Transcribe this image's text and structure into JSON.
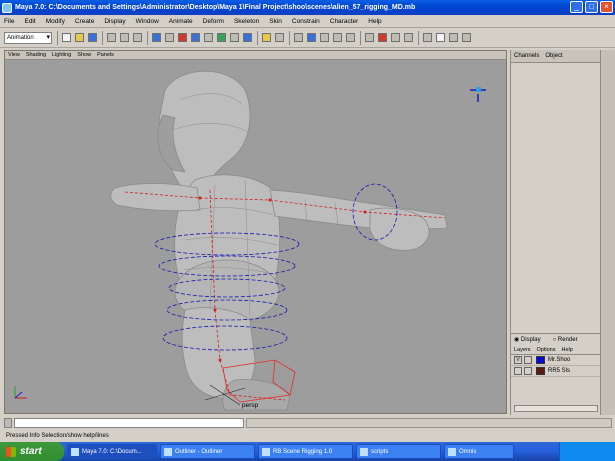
{
  "window": {
    "title": "Maya 7.0: C:\\Documents and Settings\\Administrator\\Desktop\\Maya 1\\Final Project\\shoo\\scenes\\alien_57_rigging_MD.mb",
    "minimize": "_",
    "maximize": "□",
    "close": "×"
  },
  "menubar": [
    "File",
    "Edit",
    "Modify",
    "Create",
    "Display",
    "Window",
    "Animate",
    "Deform",
    "Skeleton",
    "Skin",
    "Constrain",
    "Character",
    "Help"
  ],
  "toolbar": {
    "mode": "Animation"
  },
  "panel": {
    "menu": [
      "View",
      "Shading",
      "Lighting",
      "Show",
      "Panels"
    ],
    "camera": "persp"
  },
  "channel_box": {
    "tabs": [
      "Channels",
      "Object"
    ]
  },
  "layer_editor": {
    "radio": [
      "Display",
      "Render"
    ],
    "menu": [
      "Layers",
      "Options",
      "Help"
    ],
    "layers": [
      {
        "vis": "V",
        "name": "Mr.Shoo",
        "color": "#0a0ad0"
      },
      {
        "vis": "",
        "name": "RR5 Sls",
        "color": "#5a1a10"
      }
    ]
  },
  "help_line": "Pressed Info Selection/show help/lines",
  "taskbar": {
    "start": "start",
    "tasks": [
      "Maya 7.0: C:\\Docum...",
      "Outliner - Outliner",
      "RB Scene Rigging 1.0",
      "scripts",
      "Omnis"
    ]
  }
}
